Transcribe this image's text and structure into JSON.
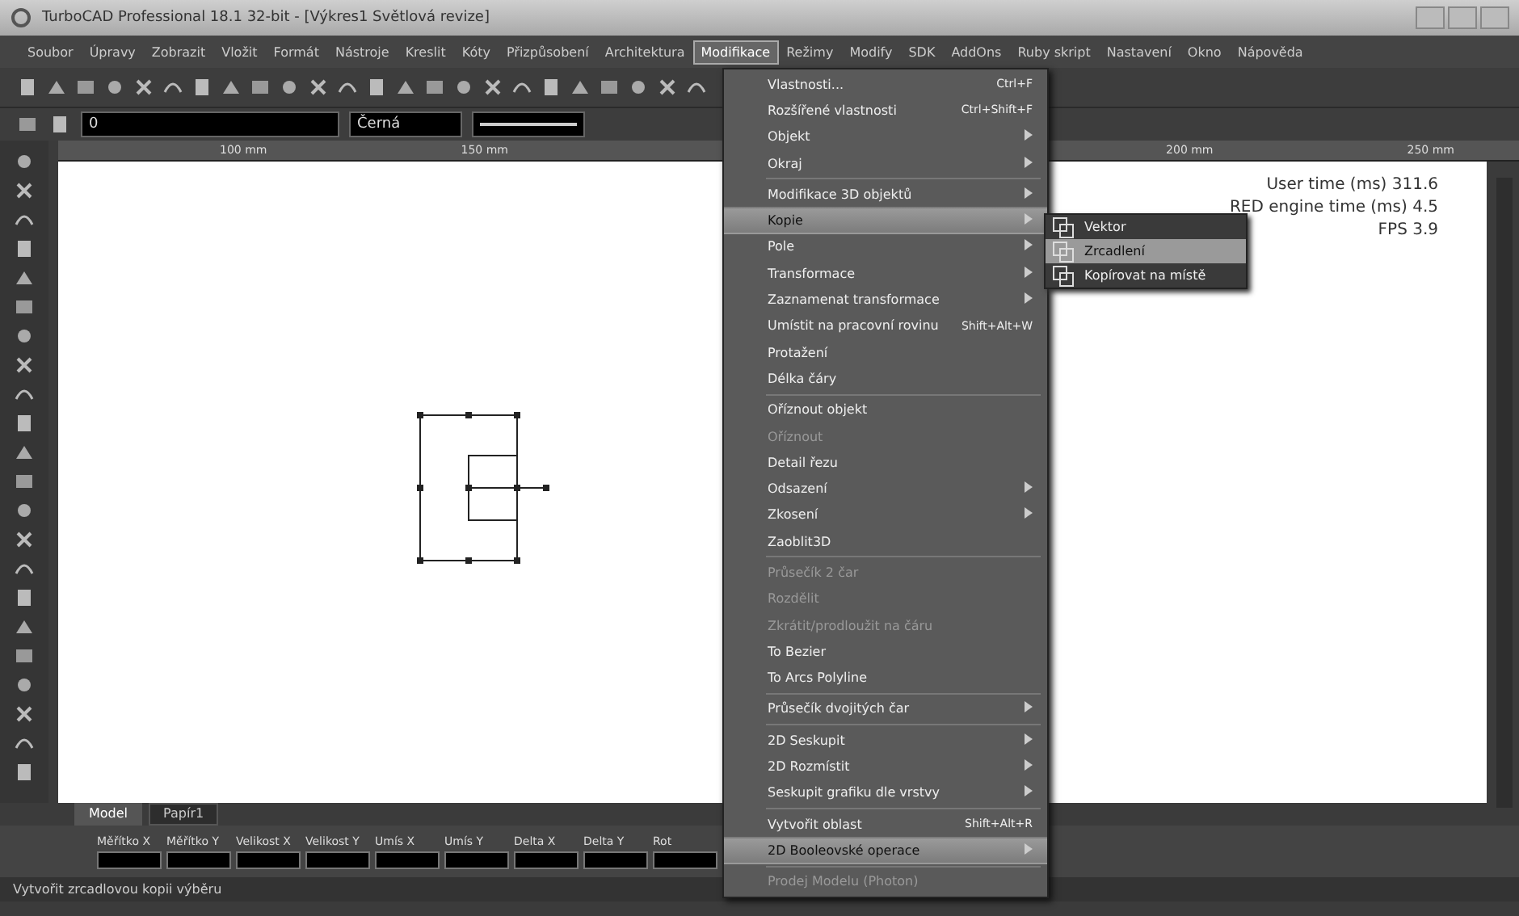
{
  "window": {
    "title": "TurboCAD Professional 18.1 32-bit - [Výkres1 Světlová revize]"
  },
  "menu_bar": [
    {
      "label": "Soubor",
      "selected": false
    },
    {
      "label": "Úpravy",
      "selected": false
    },
    {
      "label": "Zobrazit",
      "selected": false
    },
    {
      "label": "Vložit",
      "selected": false
    },
    {
      "label": "Formát",
      "selected": false
    },
    {
      "label": "Nástroje",
      "selected": false
    },
    {
      "label": "Kreslit",
      "selected": false
    },
    {
      "label": "Kóty",
      "selected": false
    },
    {
      "label": "Přizpůsobení",
      "selected": false
    },
    {
      "label": "Architektura",
      "selected": false
    },
    {
      "label": "Modifikace",
      "selected": true
    },
    {
      "label": "Režimy",
      "selected": false
    },
    {
      "label": "Modify",
      "selected": false
    },
    {
      "label": "SDK",
      "selected": false
    },
    {
      "label": "AddOns",
      "selected": false
    },
    {
      "label": "Ruby skript",
      "selected": false
    },
    {
      "label": "Nastavení",
      "selected": false
    },
    {
      "label": "Okno",
      "selected": false
    },
    {
      "label": "Nápověda",
      "selected": false
    }
  ],
  "property_bar": {
    "layer": "0",
    "color_name": "Černá"
  },
  "ruler": {
    "labels": [
      "100 mm",
      "150 mm",
      "200 mm",
      "250 mm"
    ]
  },
  "menu": [
    {
      "kind": "item",
      "label": "Vlastnosti...",
      "shortcut": "Ctrl+F",
      "submenu": false,
      "disabled": false,
      "selected": false
    },
    {
      "kind": "item",
      "label": "Rozšířené vlastnosti",
      "shortcut": "Ctrl+Shift+F",
      "submenu": false,
      "disabled": false,
      "selected": false
    },
    {
      "kind": "item",
      "label": "Objekt",
      "submenu": true,
      "disabled": false,
      "selected": false
    },
    {
      "kind": "item",
      "label": "Okraj",
      "submenu": true,
      "disabled": false,
      "selected": false
    },
    {
      "kind": "separator"
    },
    {
      "kind": "item",
      "label": "Modifikace 3D objektů",
      "submenu": true,
      "disabled": false,
      "selected": false
    },
    {
      "kind": "item",
      "label": "Kopie",
      "submenu": true,
      "disabled": false,
      "selected": true
    },
    {
      "kind": "item",
      "label": "Pole",
      "submenu": true,
      "disabled": false,
      "selected": false
    },
    {
      "kind": "item",
      "label": "Transformace",
      "submenu": true,
      "disabled": false,
      "selected": false
    },
    {
      "kind": "item",
      "label": "Zaznamenat transformace",
      "submenu": true,
      "disabled": false,
      "selected": false
    },
    {
      "kind": "item",
      "label": "Umístit na pracovní rovinu",
      "shortcut": "Shift+Alt+W",
      "submenu": false,
      "disabled": false,
      "selected": false
    },
    {
      "kind": "item",
      "label": "Protažení",
      "submenu": false,
      "disabled": false,
      "selected": false
    },
    {
      "kind": "item",
      "label": "Délka čáry",
      "submenu": false,
      "disabled": false,
      "selected": false
    },
    {
      "kind": "separator"
    },
    {
      "kind": "item",
      "label": "Oříznout objekt",
      "submenu": false,
      "disabled": false,
      "selected": false
    },
    {
      "kind": "item",
      "label": "Oříznout",
      "submenu": false,
      "disabled": true,
      "selected": false
    },
    {
      "kind": "item",
      "label": "Detail řezu",
      "submenu": false,
      "disabled": false,
      "selected": false
    },
    {
      "kind": "item",
      "label": "Odsazení",
      "submenu": true,
      "disabled": false,
      "selected": false
    },
    {
      "kind": "item",
      "label": "Zkosení",
      "submenu": true,
      "disabled": false,
      "selected": false
    },
    {
      "kind": "item",
      "label": "Zaoblit3D",
      "submenu": false,
      "disabled": false,
      "selected": false
    },
    {
      "kind": "separator"
    },
    {
      "kind": "item",
      "label": "Průsečík 2 čar",
      "submenu": false,
      "disabled": true,
      "selected": false
    },
    {
      "kind": "item",
      "label": "Rozdělit",
      "submenu": false,
      "disabled": true,
      "selected": false
    },
    {
      "kind": "item",
      "label": "Zkrátit/prodloužit na čáru",
      "submenu": false,
      "disabled": true,
      "selected": false
    },
    {
      "kind": "item",
      "label": "To Bezier",
      "submenu": false,
      "disabled": false,
      "selected": false
    },
    {
      "kind": "item",
      "label": "To Arcs Polyline",
      "submenu": false,
      "disabled": false,
      "selected": false
    },
    {
      "kind": "separator"
    },
    {
      "kind": "item",
      "label": "Průsečík dvojitých čar",
      "submenu": true,
      "disabled": false,
      "selected": false
    },
    {
      "kind": "separator"
    },
    {
      "kind": "item",
      "label": "2D Seskupit",
      "submenu": true,
      "disabled": false,
      "selected": false
    },
    {
      "kind": "item",
      "label": "2D Rozmístit",
      "submenu": true,
      "disabled": false,
      "selected": false
    },
    {
      "kind": "item",
      "label": "Seskupit grafiku dle vrstvy",
      "submenu": true,
      "disabled": false,
      "selected": false
    },
    {
      "kind": "separator"
    },
    {
      "kind": "item",
      "label": "Vytvořit oblast",
      "shortcut": "Shift+Alt+R",
      "submenu": false,
      "disabled": false,
      "selected": false
    },
    {
      "kind": "item",
      "label": "2D Booleovské operace",
      "submenu": true,
      "disabled": false,
      "selected": true
    },
    {
      "kind": "separator"
    },
    {
      "kind": "item",
      "label": "Prodej Modelu (Photon)",
      "submenu": false,
      "disabled": true,
      "selected": false
    }
  ],
  "submenu": [
    {
      "label": "Vektor",
      "selected": false
    },
    {
      "label": "Zrcadlení",
      "selected": true
    },
    {
      "label": "Kopírovat na místě",
      "selected": false
    }
  ],
  "canvas_stats": [
    {
      "label": "User time (ms)",
      "value": "311.6"
    },
    {
      "label": "RED engine time (ms)",
      "value": "4.5"
    },
    {
      "label": "FPS",
      "value": "3.9"
    }
  ],
  "tabs": [
    {
      "label": "Model",
      "selected": true
    },
    {
      "label": "Papír1",
      "selected": false
    }
  ],
  "inspector": [
    {
      "label": "Měřítko X"
    },
    {
      "label": "Měřítko Y"
    },
    {
      "label": "Velikost X"
    },
    {
      "label": "Velikost Y"
    },
    {
      "label": "Umís X"
    },
    {
      "label": "Umís Y"
    },
    {
      "label": "Delta X"
    },
    {
      "label": "Delta Y"
    },
    {
      "label": "Rot"
    }
  ],
  "status_bar": {
    "text": "Vytvořit zrcadlovou kopii výběru"
  }
}
